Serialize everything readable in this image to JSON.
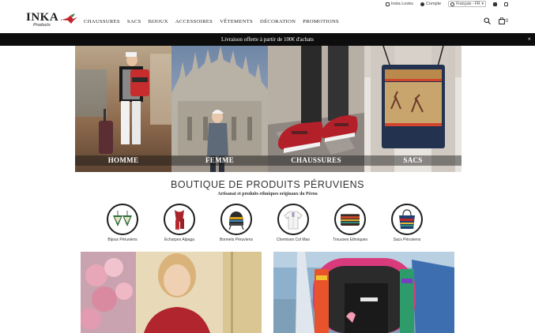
{
  "utility_bar": {
    "insta_label": "Insta Looks",
    "account_label": "Compte",
    "language_label": "Français - FR"
  },
  "header": {
    "logo_text": "INKA",
    "logo_sub": "Products",
    "nav": [
      "CHAUSSURES",
      "SACS",
      "BIJOUX",
      "ACCESSOIRES",
      "VÊTEMENTS",
      "DÉCORATION",
      "PROMOTIONS"
    ],
    "cart_count": "0"
  },
  "promo": {
    "text": "Livraison offerte à partir de 100€ d'achats",
    "close_glyph": "×"
  },
  "hero": [
    {
      "label": "HOMME"
    },
    {
      "label": "FEMME"
    },
    {
      "label": "CHAUSSURES"
    },
    {
      "label": "SACS"
    }
  ],
  "shop": {
    "title": "BOUTIQUE DE PRODUITS PÉRUVIENS",
    "subtitle": "Artisanat et produits ethniques originaux du Pérou"
  },
  "categories": [
    {
      "label": "Bijoux Péruviens",
      "icon": "earrings-icon"
    },
    {
      "label": "Echarpes Alpaga",
      "icon": "scarf-icon"
    },
    {
      "label": "Bonnets Péruviens",
      "icon": "beanie-icon"
    },
    {
      "label": "Chemises Col Mao",
      "icon": "shirt-icon"
    },
    {
      "label": "Trousses Ethniques",
      "icon": "pouch-icon"
    },
    {
      "label": "Sacs Péruviens",
      "icon": "tote-bag-icon"
    }
  ],
  "colors": {
    "promo_bg": "#0d0d0d",
    "accent_red": "#c0272d"
  }
}
